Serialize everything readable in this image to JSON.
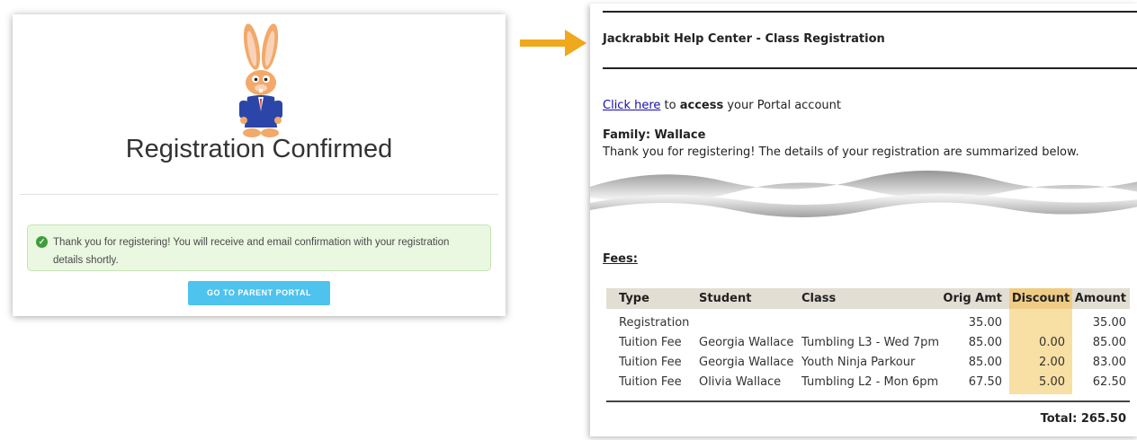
{
  "confirmation": {
    "title": "Registration Confirmed",
    "message": "Thank you for registering! You will receive and email confirmation with your registration details shortly.",
    "button_label": "GO TO PARENT PORTAL",
    "success_icon": "check-circle-icon",
    "mascot": "rabbit-mascot"
  },
  "arrow": {
    "icon": "arrow-right-icon",
    "color": "#f0a81c"
  },
  "email": {
    "header": "Jackrabbit Help Center - Class Registration",
    "access_link": "Click here",
    "access_to": " to ",
    "access_bold": "access",
    "access_rest": " your Portal account",
    "family": "Family: Wallace",
    "thanks": "Thank you for registering! The details of your registration are summarized below.",
    "fees_label": "Fees:",
    "columns": [
      "Type",
      "Student",
      "Class",
      "Orig Amt",
      "Discount",
      "Amount"
    ],
    "rows": [
      [
        "Registration",
        "",
        "",
        "35.00",
        "",
        "35.00"
      ],
      [
        "Tuition Fee",
        "Georgia Wallace",
        "Tumbling L3 - Wed 7pm",
        "85.00",
        "0.00",
        "85.00"
      ],
      [
        "Tuition Fee",
        "Georgia Wallace",
        "Youth Ninja Parkour",
        "85.00",
        "2.00",
        "83.00"
      ],
      [
        "Tuition Fee",
        "Olivia Wallace",
        "Tumbling L2 - Mon 6pm",
        "67.50",
        "5.00",
        "62.50"
      ]
    ],
    "total": "Total: 265.50",
    "colors": {
      "header_band": "#e3ded3",
      "discount_band": "#f8dfa4",
      "link": "#1a0dab"
    }
  }
}
